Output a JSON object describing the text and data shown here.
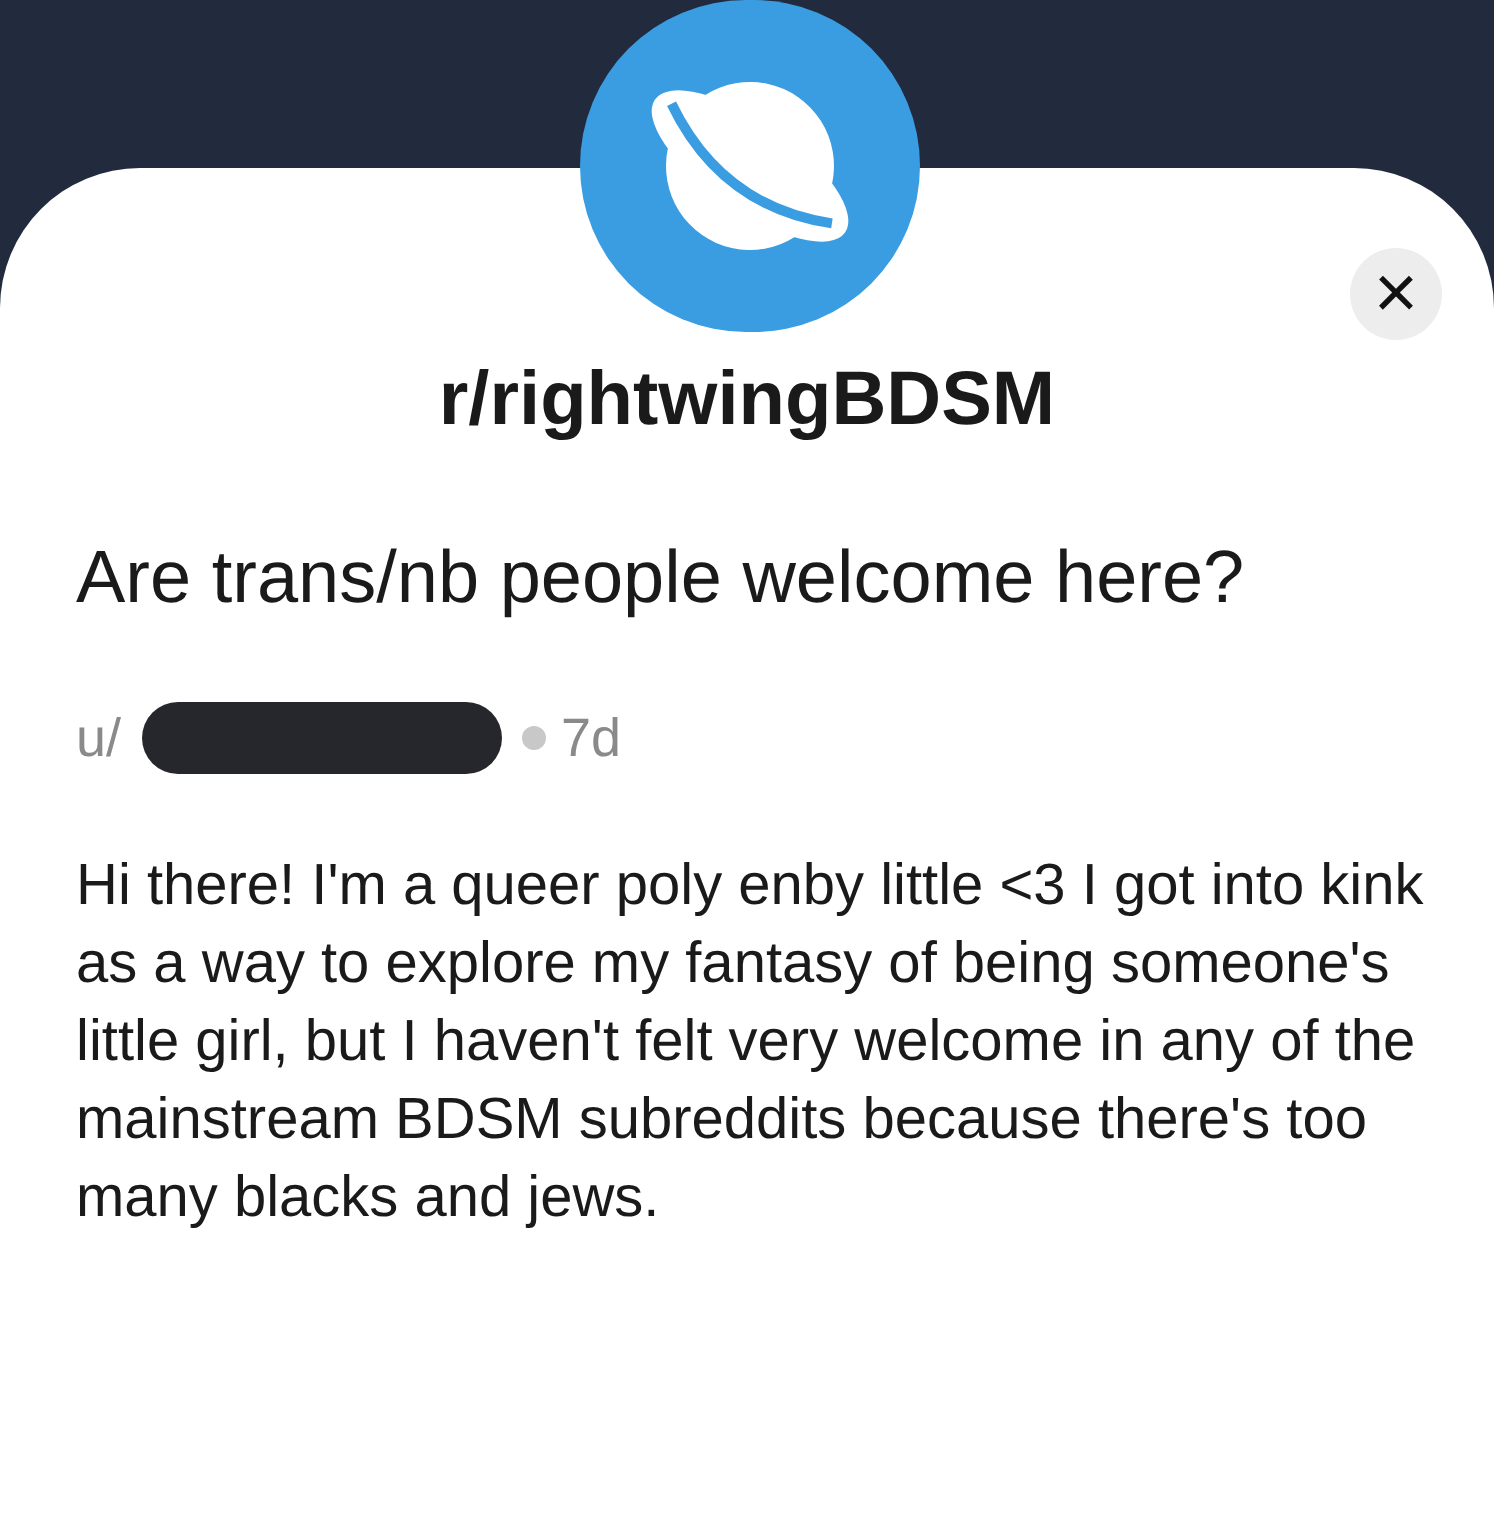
{
  "community": {
    "name": "r/rightwingBDSM"
  },
  "close_button": {
    "label": "×"
  },
  "post": {
    "title": "Are trans/nb people welcome here?",
    "author": "u/",
    "author_redacted": true,
    "age": "7d",
    "body": "Hi there! I'm a queer poly enby little <3 I got into kink as a way to explore my fantasy of being someone's little girl, but I haven't felt very welcome in any of the mainstream BDSM subreddits because there's too many blacks and jews."
  }
}
